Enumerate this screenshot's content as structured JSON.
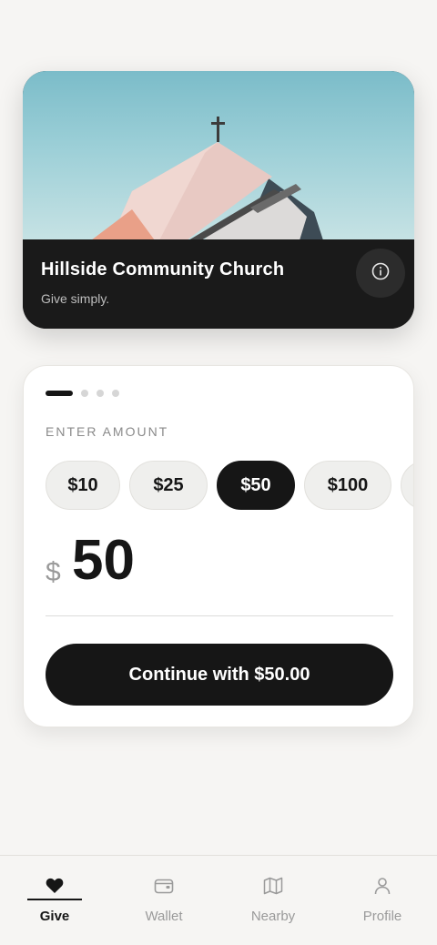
{
  "hero": {
    "title": "Hillside Community Church",
    "subtitle": "Give simply.",
    "info_icon": "info-icon"
  },
  "progress": {
    "total_steps": 4,
    "current_step": 1
  },
  "amount": {
    "label": "ENTER AMOUNT",
    "presets": [
      "$10",
      "$25",
      "$50",
      "$100"
    ],
    "selected": "$50",
    "currency_symbol": "$",
    "value": "50"
  },
  "continue_button": {
    "label": "Continue with $50.00"
  },
  "nav": {
    "items": [
      {
        "label": "Give",
        "icon": "heart-icon",
        "active": true
      },
      {
        "label": "Wallet",
        "icon": "wallet-icon",
        "active": false
      },
      {
        "label": "Nearby",
        "icon": "map-icon",
        "active": false
      },
      {
        "label": "Profile",
        "icon": "user-icon",
        "active": false
      }
    ]
  },
  "colors": {
    "background": "#f6f5f3",
    "accent": "#161616",
    "chip_bg": "#efefed",
    "muted_text": "#9a9a9a"
  }
}
